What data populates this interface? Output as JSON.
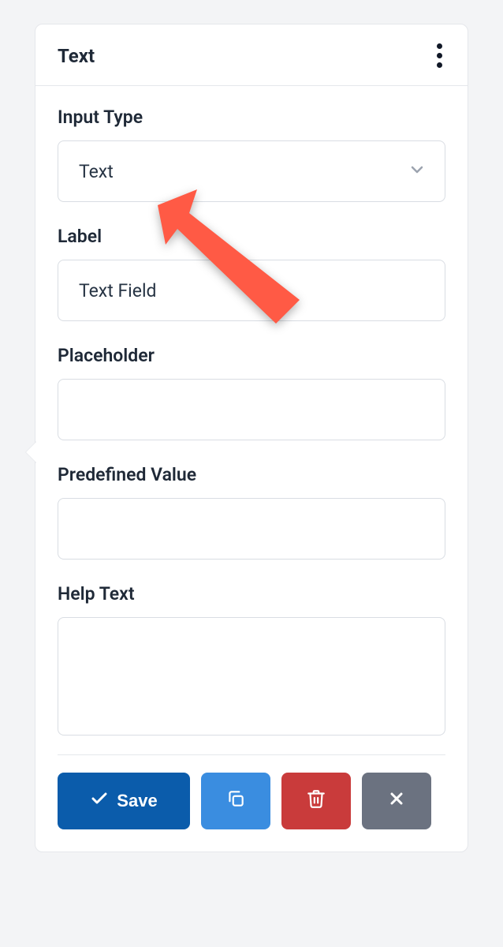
{
  "header": {
    "title": "Text"
  },
  "fields": {
    "input_type": {
      "label": "Input Type",
      "value": "Text"
    },
    "label": {
      "label": "Label",
      "value": "Text Field"
    },
    "placeholder": {
      "label": "Placeholder",
      "value": ""
    },
    "predefined_value": {
      "label": "Predefined Value",
      "value": ""
    },
    "help_text": {
      "label": "Help Text",
      "value": ""
    }
  },
  "buttons": {
    "save": "Save"
  }
}
